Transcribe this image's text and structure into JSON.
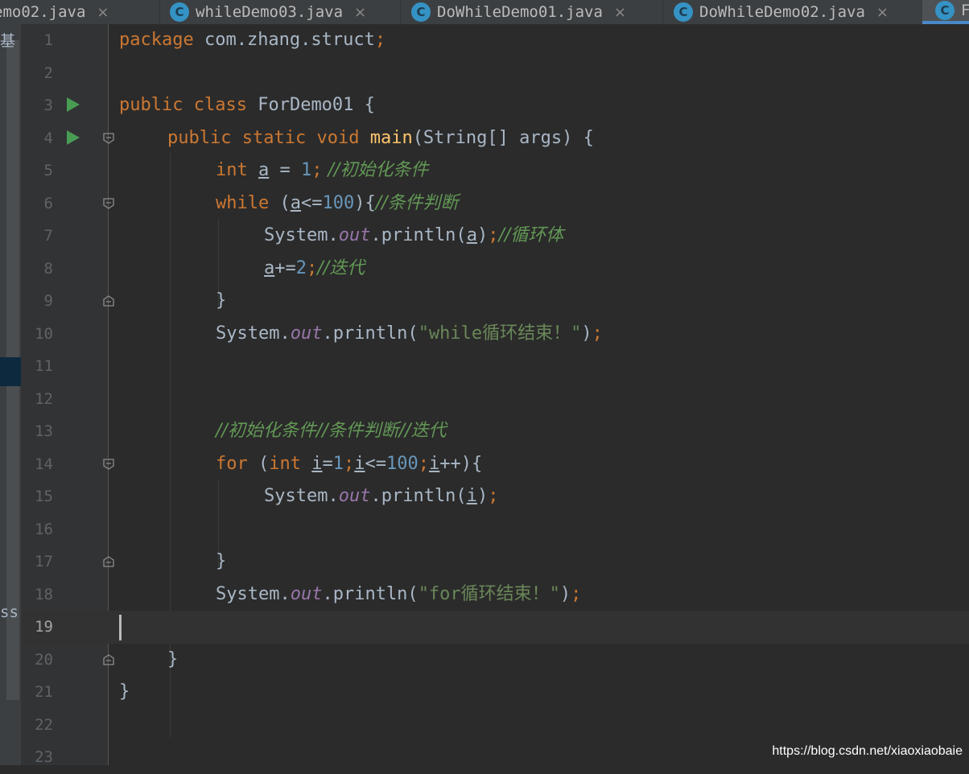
{
  "tabs": [
    {
      "label": "emo02.java",
      "icon": "class-icon",
      "has_icon": false,
      "active": false
    },
    {
      "label": "whileDemo03.java",
      "icon": "class-icon",
      "has_icon": true,
      "active": false
    },
    {
      "label": "DoWhileDemo01.java",
      "icon": "class-icon",
      "has_icon": true,
      "active": false
    },
    {
      "label": "DoWhileDemo02.java",
      "icon": "class-icon",
      "has_icon": true,
      "active": false
    },
    {
      "label": "F",
      "icon": "class-icon",
      "has_icon": true,
      "active": true
    }
  ],
  "tab_close_glyph": "×",
  "left_panel": {
    "fragment_top": "基",
    "fragment_bottom": "ss"
  },
  "editor": {
    "current_line": 19,
    "line_numbers": [
      "1",
      "2",
      "3",
      "4",
      "5",
      "6",
      "7",
      "8",
      "9",
      "10",
      "11",
      "12",
      "13",
      "14",
      "15",
      "16",
      "17",
      "18",
      "19",
      "20",
      "21",
      "22",
      "23"
    ],
    "run_markers": [
      3,
      4
    ],
    "lines": {
      "l1": {
        "kw": "package",
        "text": " com.zhang.struct",
        "semi": ";"
      },
      "l3": {
        "kw1": "public",
        "kw2": "class",
        "text": " ForDemo01 {"
      },
      "l4": {
        "kw1": "public",
        "kw2": "static",
        "kw3": "void",
        "fn": "main",
        "text": "(String[] args) {"
      },
      "l5": {
        "kw": "int",
        "var": "a",
        "op": " = ",
        "num": "1",
        "semi": ";",
        "comment": " //初始化条件"
      },
      "l6": {
        "kw": "while",
        "p1": " (",
        "var": "a",
        "op": "<=",
        "num": "100",
        "p2": "){",
        "comment": "//条件判断"
      },
      "l7": {
        "cls": "System.",
        "fld": "out",
        "call": ".println(",
        "var": "a",
        "close": ")",
        "semi": ";",
        "comment": "//循环体"
      },
      "l8": {
        "var": "a",
        "op": "+=",
        "num": "2",
        "semi": ";",
        "comment": "//迭代"
      },
      "l9": {
        "text": "}"
      },
      "l10": {
        "cls": "System.",
        "fld": "out",
        "call": ".println(",
        "str": "\"while循环结束！\"",
        "close": ")",
        "semi": ";"
      },
      "l13": {
        "comment": "//初始化条件//条件判断//迭代"
      },
      "l14": {
        "kw": "for",
        "p1": " (",
        "kw2": "int",
        "v1": "i",
        "eq": "=",
        "n1": "1",
        "s1": ";",
        "v2": "i",
        "op": "<=",
        "n2": "100",
        "s2": ";",
        "v3": "i",
        "inc": "++){"
      },
      "l15": {
        "cls": "System.",
        "fld": "out",
        "call": ".println(",
        "var": "i",
        "close": ")",
        "semi": ";"
      },
      "l17": {
        "text": "}"
      },
      "l18": {
        "cls": "System.",
        "fld": "out",
        "call": ".println(",
        "str": "\"for循环结束！\"",
        "close": ")",
        "semi": ";"
      },
      "l20": {
        "text": "}"
      },
      "l21": {
        "text": "}"
      }
    }
  },
  "watermark": "https://blog.csdn.net/xiaoxiaobaie",
  "colors": {
    "background": "#2b2b2b",
    "gutter": "#313335",
    "keyword": "#cc7832",
    "number": "#6897bb",
    "string": "#6a8759",
    "comment": "#629755",
    "field": "#9876aa",
    "function": "#ffc66d",
    "text": "#a9b7c6",
    "run_marker": "#499c54"
  }
}
